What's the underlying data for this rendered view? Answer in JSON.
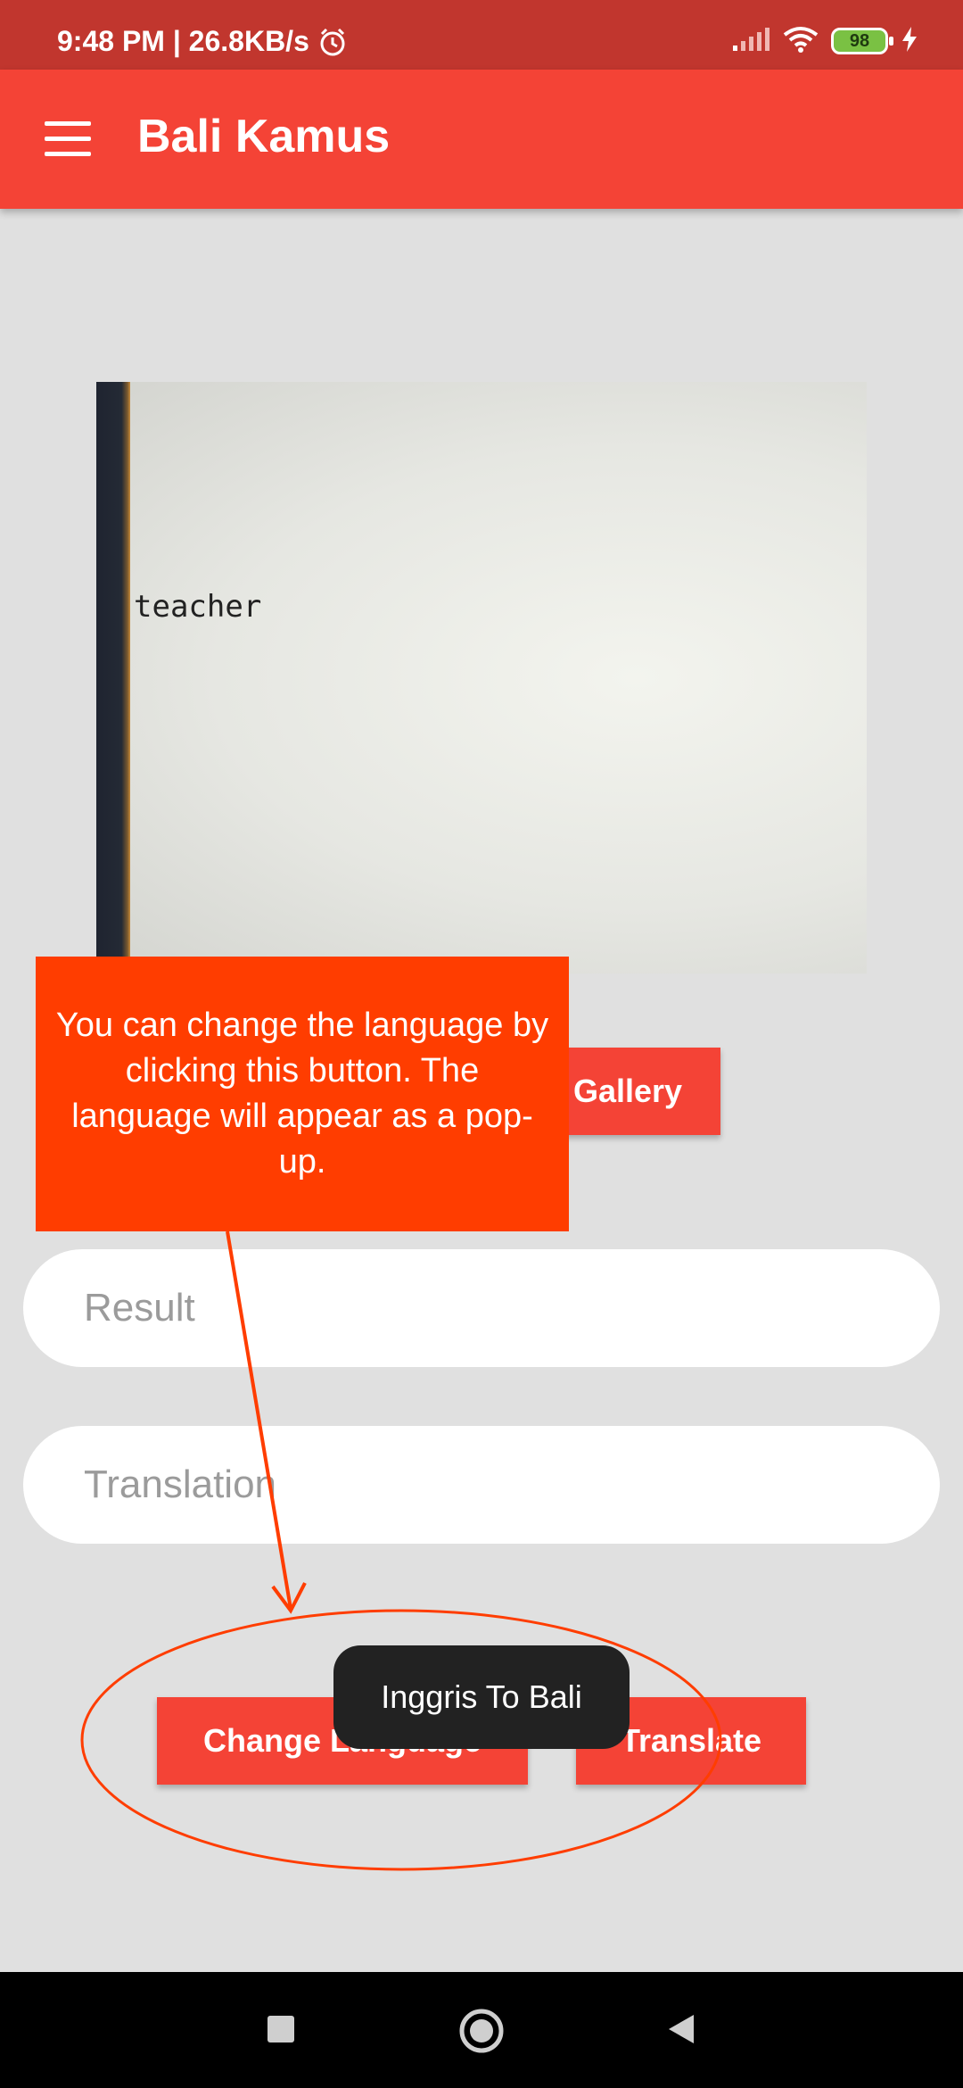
{
  "status_bar": {
    "time_speed": "9:48 PM | 26.8KB/s",
    "battery": "98",
    "icons": [
      "alarm-icon",
      "signal-icon",
      "wifi-icon",
      "battery-icon",
      "charging-icon"
    ]
  },
  "app_bar": {
    "title": "Bali Kamus",
    "menu_icon": "hamburger-menu-icon",
    "color": "#f44336"
  },
  "image_preview": {
    "text": "teacher"
  },
  "buttons": {
    "gallery": "Gallery",
    "change_language": "Change Language",
    "translate": "Translate"
  },
  "fields": {
    "result_placeholder": "Result",
    "translation_placeholder": "Translation"
  },
  "tooltip": {
    "text": "You can change the language by clicking this button. The language will appear as a pop-up.",
    "color": "#ff3d00"
  },
  "toast": {
    "text": "Inggris To Bali"
  },
  "nav_bar": {
    "icons": [
      "recent-apps-icon",
      "home-icon",
      "back-icon"
    ]
  }
}
